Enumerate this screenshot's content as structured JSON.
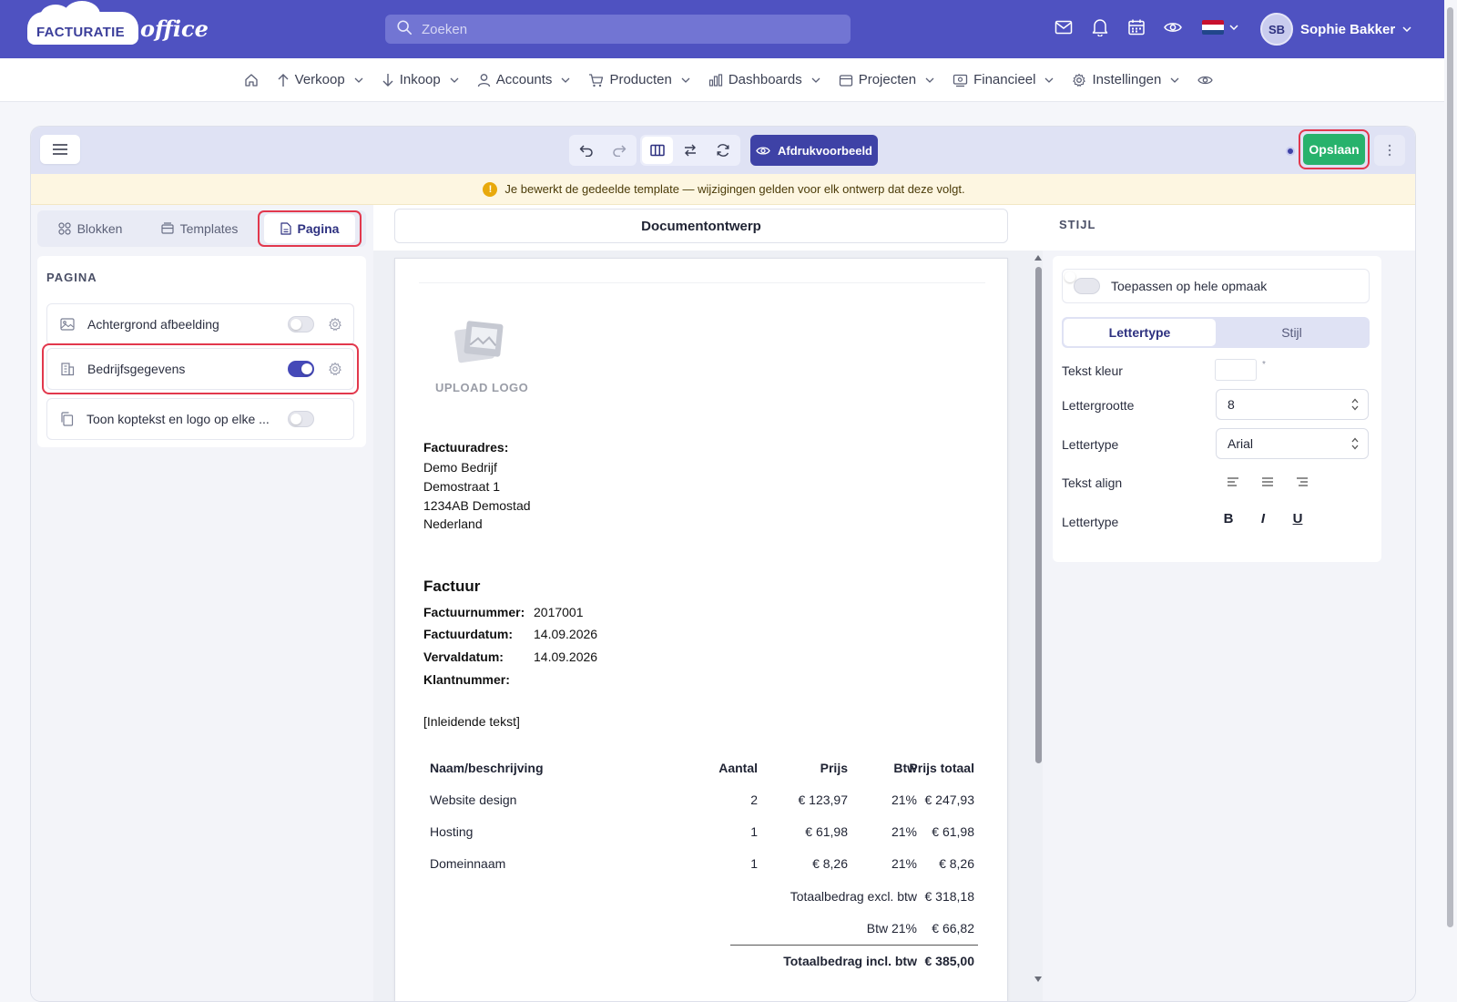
{
  "brand": {
    "name_part1": "FACTURATIE",
    "name_part2": "office"
  },
  "search": {
    "placeholder": "Zoeken"
  },
  "user": {
    "initials": "SB",
    "name": "Sophie Bakker"
  },
  "nav": {
    "items": [
      {
        "label": "Verkoop",
        "icon": "arrow-up-icon"
      },
      {
        "label": "Inkoop",
        "icon": "arrow-down-icon"
      },
      {
        "label": "Accounts",
        "icon": "user-icon"
      },
      {
        "label": "Producten",
        "icon": "cart-icon"
      },
      {
        "label": "Dashboards",
        "icon": "chart-icon"
      },
      {
        "label": "Projecten",
        "icon": "calendar-icon"
      },
      {
        "label": "Financieel",
        "icon": "finance-icon"
      },
      {
        "label": "Instellingen",
        "icon": "gear-icon"
      }
    ]
  },
  "toolbar": {
    "preview_label": "Afdrukvoorbeeld",
    "save_label": "Opslaan"
  },
  "notice": {
    "text": "Je bewerkt de gedeelde template — wijzigingen gelden voor elk ontwerp dat deze volgt."
  },
  "left": {
    "tabs": [
      {
        "label": "Blokken"
      },
      {
        "label": "Templates"
      },
      {
        "label": "Pagina"
      }
    ],
    "active_tab": "Pagina",
    "section_title": "PAGINA",
    "rows": [
      {
        "label": "Achtergrond afbeelding",
        "enabled": false,
        "has_settings": true
      },
      {
        "label": "Bedrijfsgegevens",
        "enabled": true,
        "has_settings": true
      },
      {
        "label": "Toon koptekst en logo op elke ...",
        "enabled": false,
        "has_settings": false
      }
    ]
  },
  "center": {
    "title": "Documentontwerp",
    "doc": {
      "upload_logo": "UPLOAD LOGO",
      "address_label": "Factuuradres:",
      "address": [
        "Demo Bedrijf",
        "Demostraat 1",
        "1234AB Demostad",
        "Nederland"
      ],
      "heading": "Factuur",
      "meta": [
        {
          "label": "Factuurnummer:",
          "value": "2017001"
        },
        {
          "label": "Factuurdatum:",
          "value": "14.09.2026"
        },
        {
          "label": "Vervaldatum:",
          "value": "14.09.2026"
        },
        {
          "label": "Klantnummer:",
          "value": ""
        }
      ],
      "intro": "[Inleidende tekst]",
      "table": {
        "headers": [
          "Naam/beschrijving",
          "Aantal",
          "Prijs",
          "Btw",
          "Prijs totaal"
        ],
        "rows": [
          [
            "Website design",
            "2",
            "€ 123,97",
            "21%",
            "€ 247,93"
          ],
          [
            "Hosting",
            "1",
            "€ 61,98",
            "21%",
            "€ 61,98"
          ],
          [
            "Domeinnaam",
            "1",
            "€ 8,26",
            "21%",
            "€ 8,26"
          ]
        ],
        "totals": [
          {
            "label": "Totaalbedrag excl. btw",
            "value": "€ 318,18",
            "bold": false
          },
          {
            "label": "Btw 21%",
            "value": "€ 66,82",
            "bold": false
          },
          {
            "label": "Totaalbedrag incl. btw",
            "value": "€ 385,00",
            "bold": true
          }
        ]
      }
    }
  },
  "right": {
    "title": "STIJL",
    "apply_label": "Toepassen op hele opmaak",
    "apply_enabled": false,
    "tabs": [
      {
        "label": "Lettertype"
      },
      {
        "label": "Stijl"
      }
    ],
    "active_tab": "Lettertype",
    "props": {
      "text_color_label": "Tekst kleur",
      "text_color_marker": "*",
      "font_size_label": "Lettergrootte",
      "font_size_value": "8",
      "font_label": "Lettertype",
      "font_value": "Arial",
      "align_label": "Tekst align",
      "format_label": "Lettertype",
      "bold": "B",
      "italic": "I",
      "underline": "U"
    }
  },
  "colors": {
    "brand": "#4f52c1",
    "save": "#27b26c",
    "highlight": "#e2384d",
    "preview": "#3e42a6",
    "notice_bg": "#fdf6e1"
  }
}
